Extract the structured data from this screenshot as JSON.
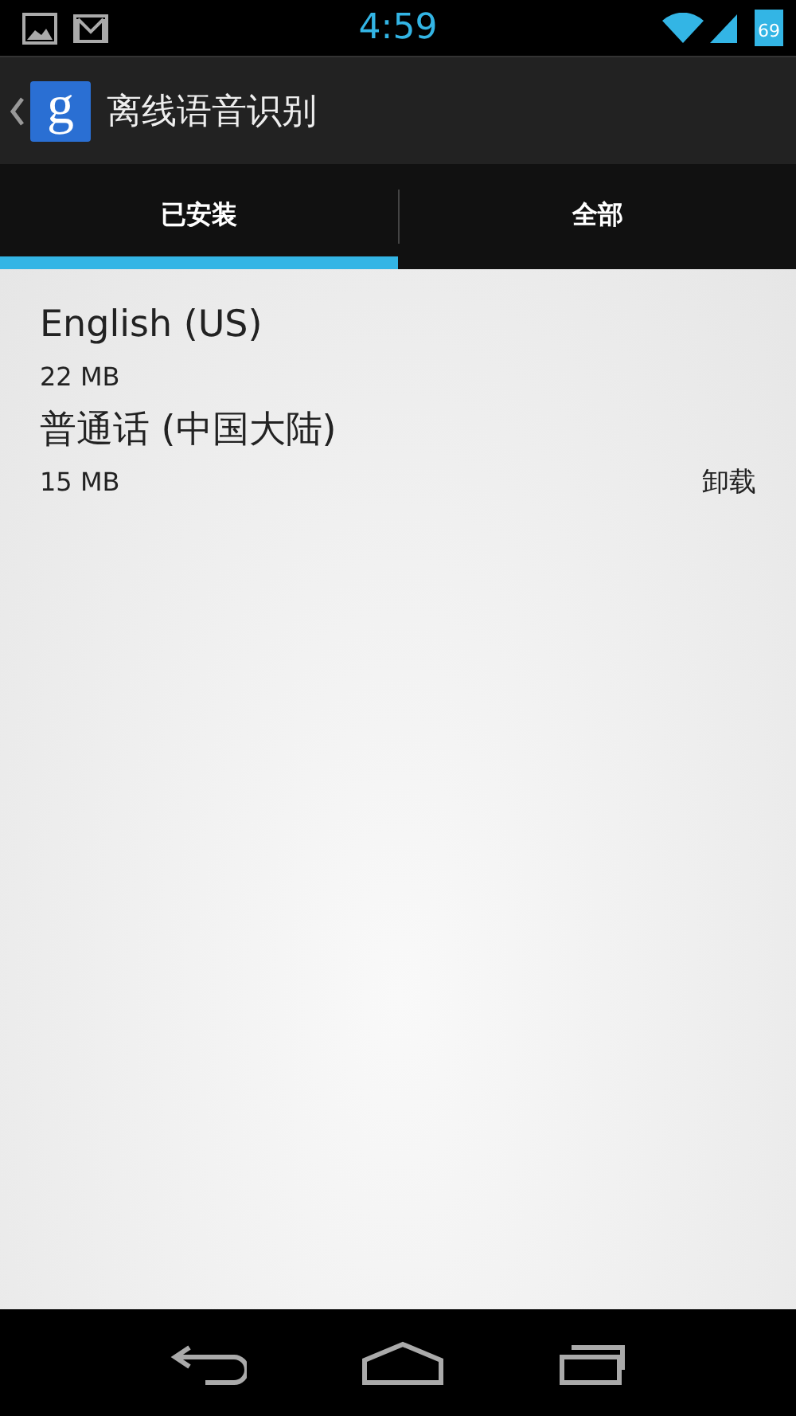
{
  "status_bar": {
    "time": "4:59",
    "battery": "69"
  },
  "action_bar": {
    "app_icon_letter": "g",
    "title": "离线语音识别"
  },
  "tabs": [
    {
      "label": "已安装",
      "selected": true
    },
    {
      "label": "全部",
      "selected": false
    }
  ],
  "languages": [
    {
      "name": "English (US)",
      "size": "22 MB"
    },
    {
      "name": "普通话 (中国大陆)",
      "size": "15 MB",
      "action": "卸载"
    }
  ]
}
